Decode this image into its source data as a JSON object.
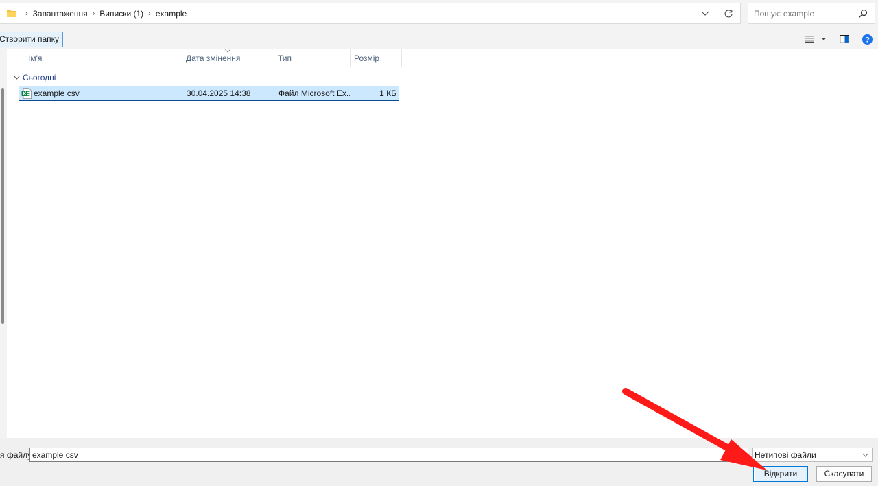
{
  "address_bar": {
    "breadcrumbs": [
      "Завантаження",
      "Виписки (1)",
      "example"
    ]
  },
  "search": {
    "placeholder": "Пошук: example"
  },
  "toolbar": {
    "new_folder_label": "Створити папку"
  },
  "columns": {
    "name": "Ім'я",
    "date": "Дата змінення",
    "type": "Тип",
    "size": "Розмір"
  },
  "groups": [
    {
      "label": "Сьогодні",
      "files": [
        {
          "name": "example csv",
          "date": "30.04.2025 14:38",
          "type": "Файл Microsoft Ex...",
          "size": "1 КБ",
          "icon": "excel-file-icon",
          "selected": true
        }
      ]
    }
  ],
  "bottom": {
    "filename_label": "я файлу:",
    "filename_value": "example csv",
    "filter_value": "Нетипові файли",
    "open_label": "Відкрити",
    "cancel_label": "Скасувати"
  },
  "colors": {
    "selection": "#cce8ff",
    "accent": "#0078d7",
    "annotation": "#ff0000"
  }
}
